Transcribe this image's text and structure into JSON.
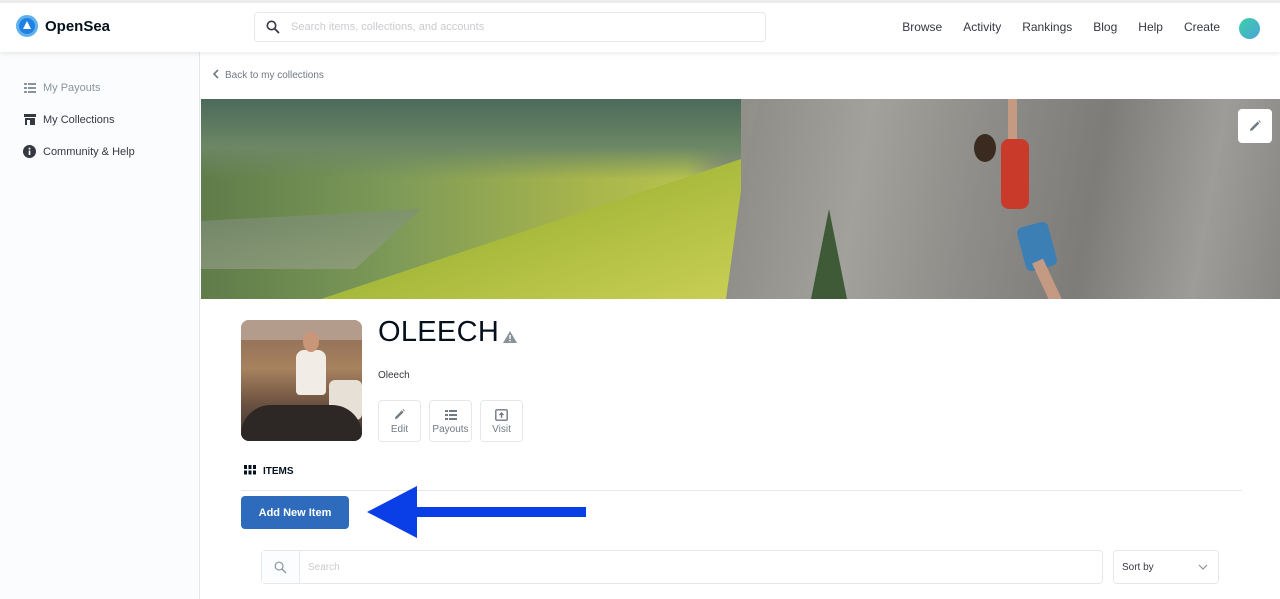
{
  "header": {
    "brand": "OpenSea",
    "search_placeholder": "Search items, collections, and accounts",
    "nav": [
      "Browse",
      "Activity",
      "Rankings",
      "Blog",
      "Help",
      "Create"
    ]
  },
  "sidebar": {
    "items": [
      {
        "label": "My Payouts",
        "icon": "list-icon"
      },
      {
        "label": "My Collections",
        "icon": "store-icon"
      },
      {
        "label": "Community & Help",
        "icon": "info-icon"
      }
    ]
  },
  "breadcrumb": {
    "back_label": "Back to my collections"
  },
  "collection": {
    "title": "OLEECH",
    "owner": "Oleech",
    "actions": [
      {
        "label": "Edit",
        "icon": "pencil-icon"
      },
      {
        "label": "Payouts",
        "icon": "list-icon"
      },
      {
        "label": "Visit",
        "icon": "external-open-icon"
      }
    ]
  },
  "items_section": {
    "header": "ITEMS",
    "add_button": "Add New Item",
    "search_placeholder": "Search",
    "sort_label": "Sort by"
  },
  "annotation": {
    "arrow_color": "#0a3ee6"
  },
  "colors": {
    "primary_button": "#2e6bbd",
    "brand_blue": "#2081e2"
  }
}
